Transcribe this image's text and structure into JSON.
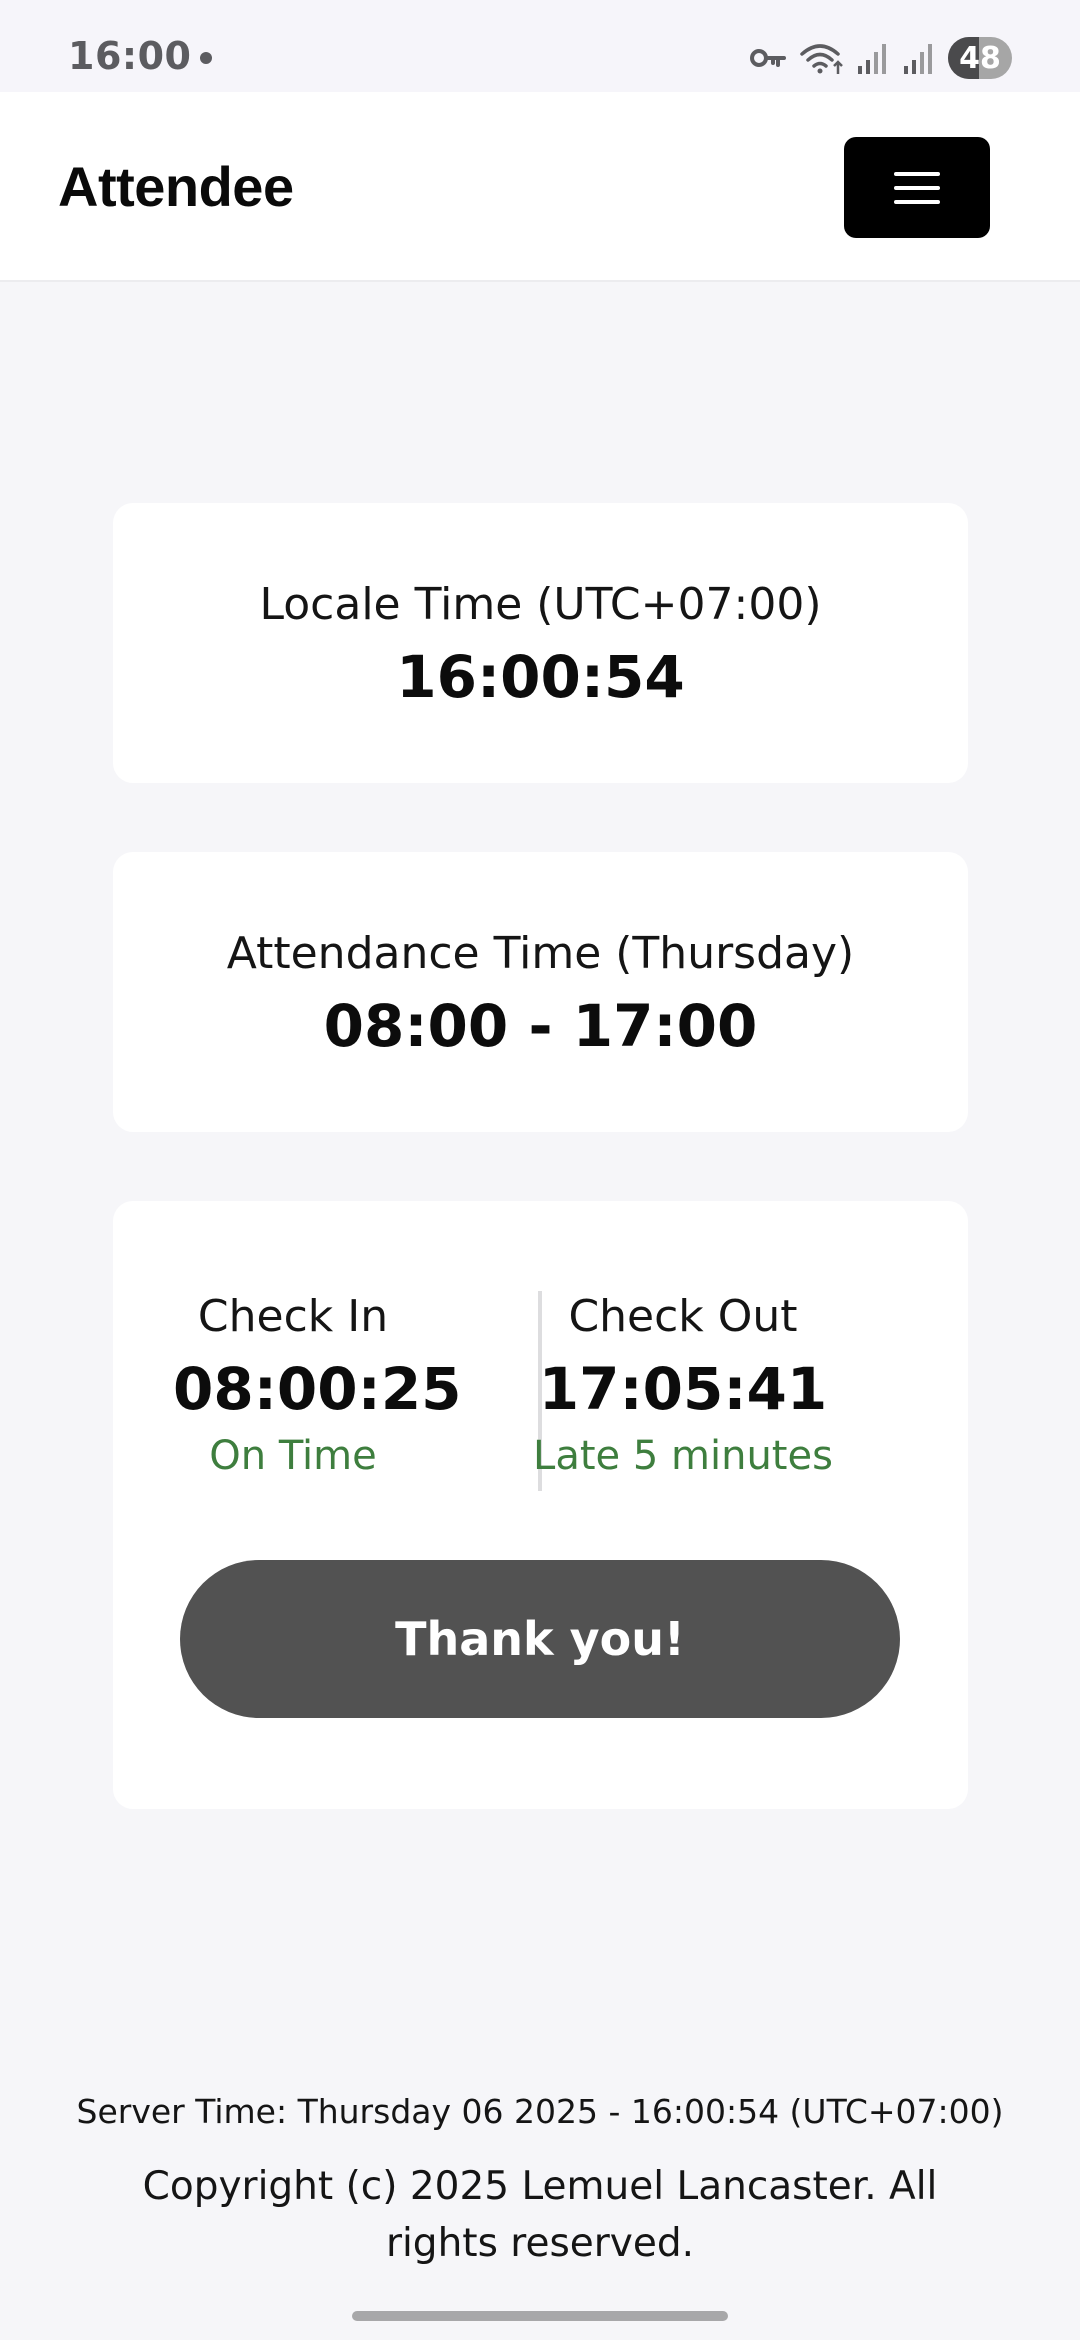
{
  "status_bar": {
    "time": "16:00",
    "battery_level": "48",
    "battery_fraction": 0.48,
    "icons": [
      "notification-dot-icon",
      "vpn-key-icon",
      "wifi-icon",
      "signal-icon",
      "signal-icon-2",
      "battery-icon"
    ]
  },
  "navbar": {
    "brand": "Attendee",
    "menu_icon": "hamburger-menu-icon"
  },
  "locale_card": {
    "label": "Locale Time (UTC+07:00)",
    "value": "16:00:54"
  },
  "attendance_card": {
    "label": "Attendance Time (Thursday)",
    "value": "08:00 - 17:00"
  },
  "check_card": {
    "check_in": {
      "label": "Check In",
      "time": "08:00:25",
      "status": "On Time"
    },
    "check_out": {
      "label": "Check Out",
      "time": "17:05:41",
      "status": "Late 5 minutes"
    },
    "button_label": "Thank you!"
  },
  "footer": {
    "server_time": "Server Time: Thursday 06 2025 - 16:00:54 (UTC+07:00)",
    "copyright": "Copyright (c) 2025 Lemuel Lancaster. All rights reserved."
  },
  "colors": {
    "page_background": "#f6f6f9",
    "card_background": "#ffffff",
    "status_green": "#3e7e3e",
    "button_gray": "#525252",
    "menu_button": "#000000"
  }
}
